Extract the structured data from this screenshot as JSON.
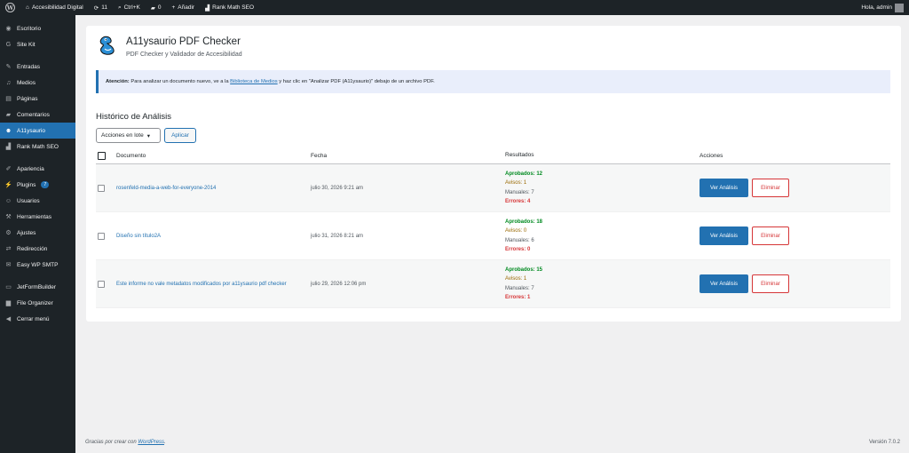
{
  "adminbar": {
    "site_name": "Accesibilidad Digital",
    "updates_count": "11",
    "shortcut": "Ctrl+K",
    "comments_count": "0",
    "add_new": "Añadir",
    "rank_math": "Rank Math SEO",
    "greeting": "Hola, admin"
  },
  "sidebar": {
    "items": [
      {
        "label": "Escritorio",
        "icon": "dashboard-icon"
      },
      {
        "label": "Site Kit",
        "icon": "sitekit-icon"
      },
      {
        "label": "Entradas",
        "icon": "pin-icon"
      },
      {
        "label": "Medios",
        "icon": "media-icon"
      },
      {
        "label": "Páginas",
        "icon": "pages-icon"
      },
      {
        "label": "Comentarios",
        "icon": "comment-icon"
      },
      {
        "label": "A11ysaurio",
        "icon": "dino-icon"
      },
      {
        "label": "Rank Math SEO",
        "icon": "rankmath-icon"
      },
      {
        "label": "Apariencia",
        "icon": "brush-icon"
      },
      {
        "label": "Plugins",
        "icon": "plugin-icon",
        "badge": "7"
      },
      {
        "label": "Usuarios",
        "icon": "users-icon"
      },
      {
        "label": "Herramientas",
        "icon": "tools-icon"
      },
      {
        "label": "Ajustes",
        "icon": "settings-icon"
      },
      {
        "label": "Redirección",
        "icon": "redirect-icon"
      },
      {
        "label": "Easy WP SMTP",
        "icon": "mail-icon"
      },
      {
        "label": "JetFormBuilder",
        "icon": "form-icon"
      },
      {
        "label": "File Organizer",
        "icon": "folder-icon"
      },
      {
        "label": "Cerrar menú",
        "icon": "collapse-icon"
      }
    ]
  },
  "header": {
    "title": "A11ysaurio PDF Checker",
    "subtitle": "PDF Checker y Validador de Accesibilidad"
  },
  "notice": {
    "strong": "Atención:",
    "text_before": " Para analizar un documento nuevo, ve a la ",
    "link": "Biblioteca de Medios",
    "text_after": " y haz clic en \"Analizar PDF (A11ysaurio)\" debajo de un archivo PDF."
  },
  "history": {
    "title": "Histórico de Análisis",
    "bulk_label": "Acciones en lote",
    "apply_label": "Aplicar",
    "columns": {
      "document": "Documento",
      "date": "Fecha",
      "results": "Resultados",
      "actions": "Acciones"
    },
    "rows": [
      {
        "document": "rosenfeld-media-a-web-for-everyone-2014",
        "date": "julio 30, 2026 9:21 am",
        "passed": "Aprobados: 12",
        "warnings": "Avisos: 1",
        "manual": "Manuales: 7",
        "errors": "Errores: 4",
        "view": "Ver Análisis",
        "delete": "Eliminar"
      },
      {
        "document": "Diseño sin título2A",
        "date": "julio 31, 2026 8:21 am",
        "passed": "Aprobados: 18",
        "warnings": "Avisos: 0",
        "manual": "Manuales: 6",
        "errors": "Errores: 0",
        "view": "Ver Análisis",
        "delete": "Eliminar"
      },
      {
        "document": "Este informe no vale metadatos modificados por a11ysaurio pdf checker",
        "date": "julio 29, 2026 12:06 pm",
        "passed": "Aprobados: 15",
        "warnings": "Avisos: 1",
        "manual": "Manuales: 7",
        "errors": "Errores: 1",
        "view": "Ver Análisis",
        "delete": "Eliminar"
      }
    ]
  },
  "footer": {
    "thanks_before": "Gracias por crear con ",
    "thanks_link": "WordPress",
    "thanks_after": ".",
    "version": "Versión 7.0.2"
  },
  "colors": {
    "accent": "#2271b1",
    "sidebar_bg": "#1d2327",
    "success": "#008a20",
    "warning": "#996800",
    "danger": "#d63638"
  }
}
